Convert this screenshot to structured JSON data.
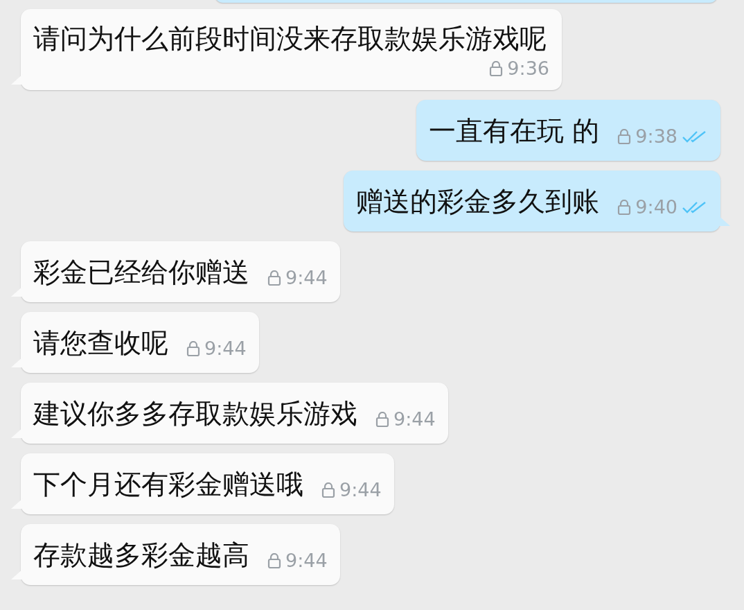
{
  "messages": [
    {
      "kind": "incoming",
      "text": "请问为什么前段时间没来存取款娱乐游戏呢",
      "time": "9:36",
      "wrap_time": true
    },
    {
      "kind": "outgoing",
      "text": "一直有在玩 的",
      "time": "9:38",
      "read": true
    },
    {
      "kind": "outgoing",
      "text": "赠送的彩金多久到账",
      "time": "9:40",
      "read": true
    },
    {
      "kind": "incoming",
      "text": "彩金已经给你赠送",
      "time": "9:44"
    },
    {
      "kind": "incoming",
      "text": "请您查收呢",
      "time": "9:44"
    },
    {
      "kind": "incoming",
      "text": "建议你多多存取款娱乐游戏",
      "time": "9:44"
    },
    {
      "kind": "incoming",
      "text": "下个月还有彩金赠送哦",
      "time": "9:44"
    },
    {
      "kind": "incoming",
      "text": "存款越多彩金越高",
      "time": "9:44"
    }
  ]
}
